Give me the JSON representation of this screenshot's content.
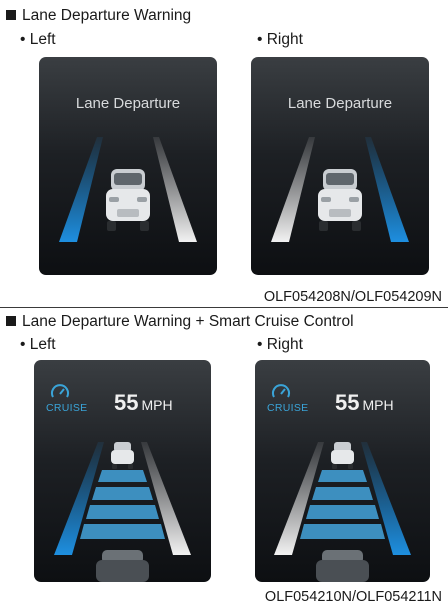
{
  "section1": {
    "title": "Lane Departure Warning",
    "left_label": "• Left",
    "right_label": "• Right",
    "left_panel_text": "Lane Departure",
    "right_panel_text": "Lane Departure",
    "code": "OLF054208N/OLF054209N"
  },
  "section2": {
    "title": "Lane Departure Warning + Smart Cruise Control",
    "left_label": "• Left",
    "right_label": "• Right",
    "cruise_label": "CRUISE",
    "speed_value": "55",
    "speed_unit": "MPH",
    "code": "OLF054210N/OLF054211N"
  },
  "colors": {
    "lane_warning": "#1e8fe0",
    "lane_normal": "#f2f2f2",
    "panel_dark": "#111418",
    "cruise_blue": "#3aa4d8"
  },
  "icons": [
    "cruise-gauge-icon",
    "car-rear-icon"
  ]
}
